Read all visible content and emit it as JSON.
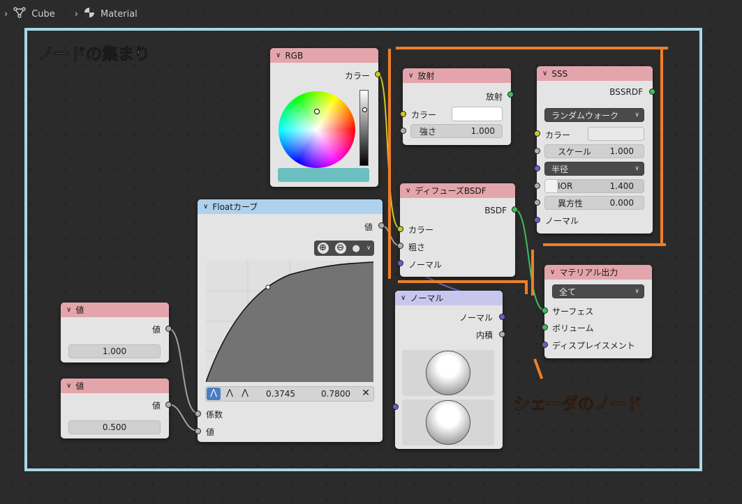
{
  "breadcrumb": {
    "object": "Cube",
    "material": "Material"
  },
  "frame": {
    "label": "ノードの集まり"
  },
  "shader_label": "シェーダのノード",
  "colors": {
    "frame": "#a9d8ea",
    "highlight": "#f07e28",
    "header_red": "#e3a5ab",
    "header_blue": "#aed2ee",
    "header_lavender": "#c7c7ee",
    "rgb_swatch": "#6cbfc0"
  },
  "nodes": {
    "rgb": {
      "title": "RGB",
      "out": "カラー"
    },
    "emission": {
      "title": "放射",
      "out": "放射",
      "color_label": "カラー",
      "strength_label": "強さ",
      "strength": "1.000"
    },
    "sss": {
      "title": "SSS",
      "out": "BSSRDF",
      "method": "ランダムウォーク",
      "color_label": "カラー",
      "scale_label": "スケール",
      "scale": "1.000",
      "radius_label": "半径",
      "ior_label": "IOR",
      "ior": "1.400",
      "anisotropy_label": "異方性",
      "anisotropy": "0.000",
      "normal_label": "ノーマル"
    },
    "diffuse": {
      "title": "ディフューズBSDF",
      "out": "BSDF",
      "color_label": "カラー",
      "roughness_label": "粗さ",
      "normal_label": "ノーマル"
    },
    "float_curve": {
      "title": "Floatカーブ",
      "out": "値",
      "x": "0.3745",
      "y": "0.7800",
      "factor_label": "係数",
      "value_label": "値"
    },
    "value1": {
      "title": "値",
      "out": "値",
      "value": "1.000"
    },
    "value2": {
      "title": "値",
      "out": "値",
      "value": "0.500"
    },
    "normal": {
      "title": "ノーマル",
      "out_normal": "ノーマル",
      "out_dot": "内積"
    },
    "material_output": {
      "title": "マテリアル出力",
      "target": "全て",
      "surface": "サーフェス",
      "volume": "ボリューム",
      "displacement": "ディスプレイスメント"
    }
  }
}
